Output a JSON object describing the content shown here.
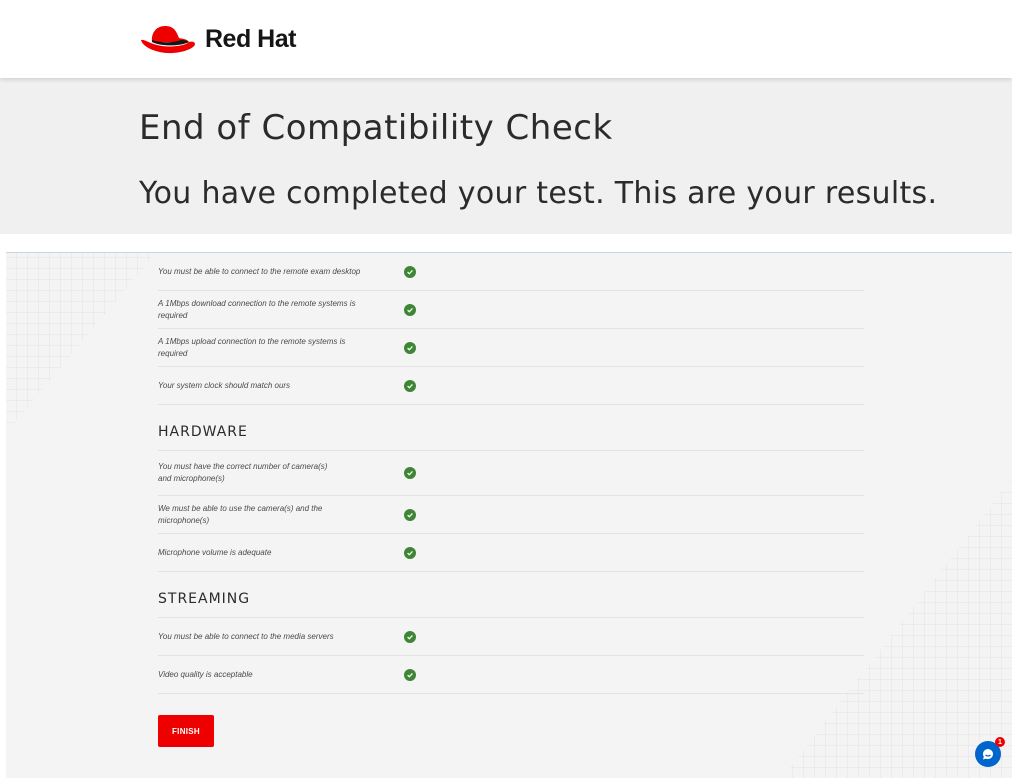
{
  "brand": {
    "name": "Red Hat",
    "color": "#ee0000"
  },
  "page": {
    "title": "End of Compatibility Check",
    "subtitle": "You have completed your test. This are your results."
  },
  "checks": {
    "general": [
      {
        "label": "You must be able to connect to the remote exam desktop",
        "status": "pass"
      },
      {
        "label": "A 1Mbps download connection to the remote systems is required",
        "status": "pass"
      },
      {
        "label": "A 1Mbps upload connection to the remote systems is required",
        "status": "pass"
      },
      {
        "label": "Your system clock should match ours",
        "status": "pass"
      }
    ],
    "hardware": {
      "heading": "HARDWARE",
      "items": [
        {
          "label": "You must have the correct number of camera(s) and microphone(s)",
          "status": "pass"
        },
        {
          "label": "We must be able to use the camera(s) and the microphone(s)",
          "status": "pass"
        },
        {
          "label": "Microphone volume is adequate",
          "status": "pass"
        }
      ]
    },
    "streaming": {
      "heading": "STREAMING",
      "items": [
        {
          "label": "You must be able to connect to the media servers",
          "status": "pass"
        },
        {
          "label": "Video quality is acceptable",
          "status": "pass"
        }
      ]
    }
  },
  "finish_button": {
    "label": "FINISH"
  },
  "chat": {
    "icon": "chat-bubble-icon",
    "badge_count": "1"
  },
  "colors": {
    "pass": "#3e8635",
    "accent": "#ee0000",
    "chat": "#0066cc"
  }
}
